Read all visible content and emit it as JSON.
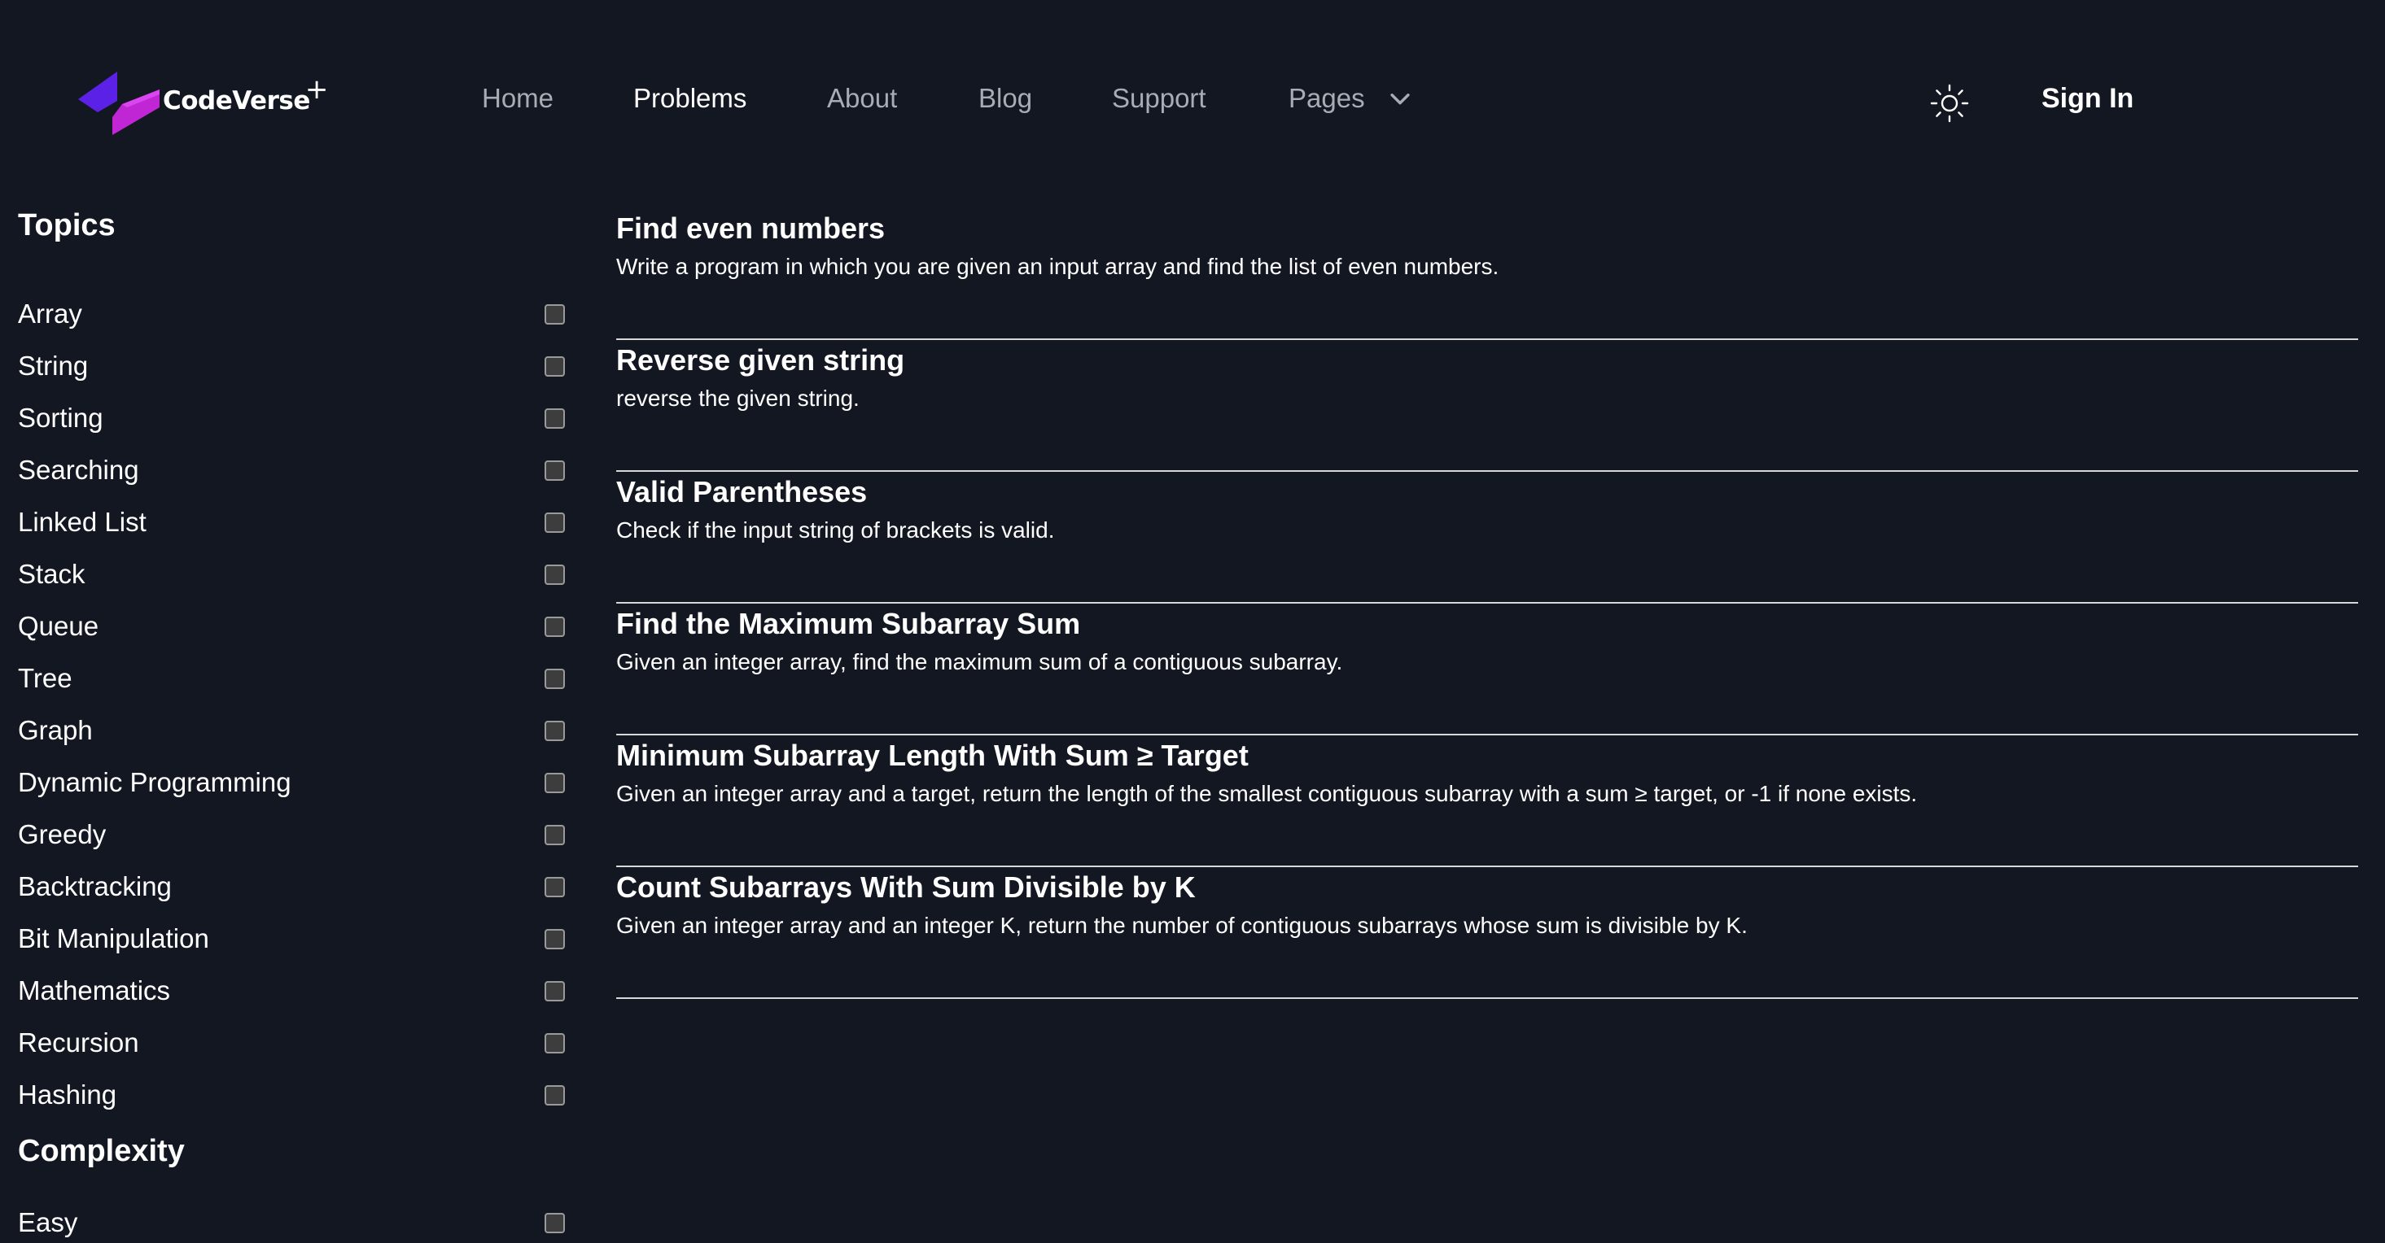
{
  "brand": {
    "name": "CodeVerse",
    "superscript": "+"
  },
  "nav": {
    "home": "Home",
    "problems": "Problems",
    "about": "About",
    "blog": "Blog",
    "support": "Support",
    "pages": "Pages",
    "sign_in": "Sign In",
    "theme_icon": "sun-icon",
    "pages_icon": "chevron-down-icon"
  },
  "sidebar": {
    "topics_heading": "Topics",
    "topics": [
      "Array",
      "String",
      "Sorting",
      "Searching",
      "Linked List",
      "Stack",
      "Queue",
      "Tree",
      "Graph",
      "Dynamic Programming",
      "Greedy",
      "Backtracking",
      "Bit Manipulation",
      "Mathematics",
      "Recursion",
      "Hashing"
    ],
    "complexity_heading": "Complexity",
    "complexity": [
      "Easy"
    ]
  },
  "problems": [
    {
      "title": "Find even numbers",
      "description": "Write a program in which you are given an input array and find the list of even numbers."
    },
    {
      "title": "Reverse given string",
      "description": "reverse the given string."
    },
    {
      "title": "Valid Parentheses",
      "description": "Check if the input string of brackets is valid."
    },
    {
      "title": "Find the Maximum Subarray Sum",
      "description": "Given an integer array, find the maximum sum of a contiguous subarray."
    },
    {
      "title": "Minimum Subarray Length With Sum ≥ Target",
      "description": "Given an integer array and a target, return the length of the smallest contiguous subarray with a sum ≥ target, or -1 if none exists."
    },
    {
      "title": "Count Subarrays With Sum Divisible by K",
      "description": "Given an integer array and an integer K, return the number of contiguous subarrays whose sum is divisible by K."
    }
  ],
  "colors": {
    "background": "#131722",
    "logo_purple": "#5b21e6",
    "logo_magenta": "#c026d3",
    "nav_inactive": "#a8acb4",
    "divider": "#d8d8d8"
  }
}
